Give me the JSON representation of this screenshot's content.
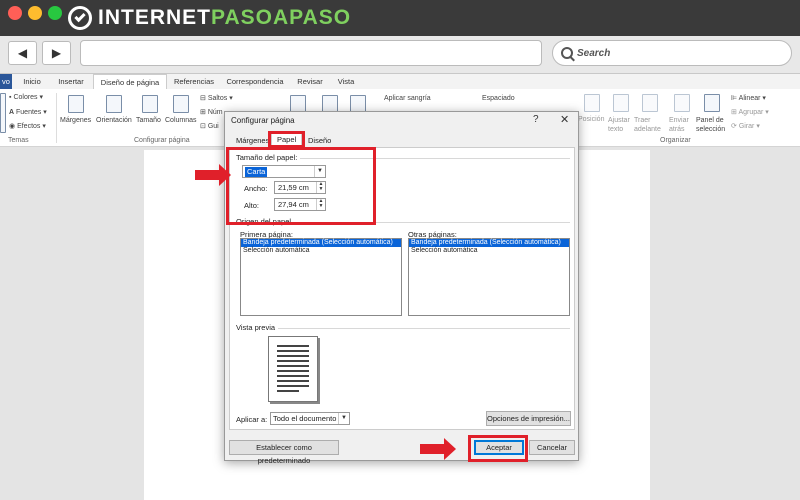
{
  "brand": {
    "prefix": "INTERNET",
    "highlight": "PASOAPASO"
  },
  "browser": {
    "search_placeholder": "Search",
    "back_glyph": "◀",
    "forward_glyph": "▶"
  },
  "ribbon_tabs": [
    {
      "label": "vo"
    },
    {
      "label": "Inicio"
    },
    {
      "label": "Insertar"
    },
    {
      "label": "Diseño de página"
    },
    {
      "label": "Referencias"
    },
    {
      "label": "Correspondencia"
    },
    {
      "label": "Revisar"
    },
    {
      "label": "Vista"
    }
  ],
  "ribbon": {
    "temas": {
      "colores": "Colores",
      "fuentes": "Fuentes",
      "efectos": "Efectos",
      "group": "Temas"
    },
    "configurar": {
      "margenes": "Márgenes",
      "orientacion": "Orientación",
      "tamano": "Tamaño",
      "columnas": "Columnas",
      "saltos": "Saltos",
      "numeros": "Núm",
      "guiones": "Gui",
      "group": "Configurar página"
    },
    "parrafo": {
      "sangria": "Aplicar sangría",
      "espaciado": "Espaciado"
    },
    "organizar": {
      "posicion": "Posición",
      "ajustar": "Ajustar\ntexto",
      "traer": "Traer\nadelante",
      "enviar": "Enviar\natrás",
      "panel": "Panel de\nselección",
      "alinear": "Alinear",
      "agrupar": "Agrupar",
      "girar": "Girar",
      "group": "Organizar"
    }
  },
  "dialog": {
    "title": "Configurar página",
    "help": "?",
    "close": "✕",
    "tabs": [
      "Márgenes",
      "Papel",
      "Diseño"
    ],
    "paper_size_label": "Tamaño del papel:",
    "paper_size_value": "Carta",
    "width_label": "Ancho:",
    "width_value": "21,59 cm",
    "height_label": "Alto:",
    "height_value": "27,94 cm",
    "paper_source_label": "Origen del papel",
    "first_page_label": "Primera página:",
    "other_pages_label": "Otras páginas:",
    "first_page_items": [
      "Bandeja predeterminada (Selección automática)",
      "Selección automática"
    ],
    "other_pages_items": [
      "Bandeja predeterminada (Selección automática)",
      "Selección automática"
    ],
    "preview_label": "Vista previa",
    "apply_label": "Aplicar a:",
    "apply_value": "Todo el documento",
    "print_options": "Opciones de impresión...",
    "set_default": "Establecer como predeterminado",
    "accept": "Aceptar",
    "cancel": "Cancelar"
  }
}
